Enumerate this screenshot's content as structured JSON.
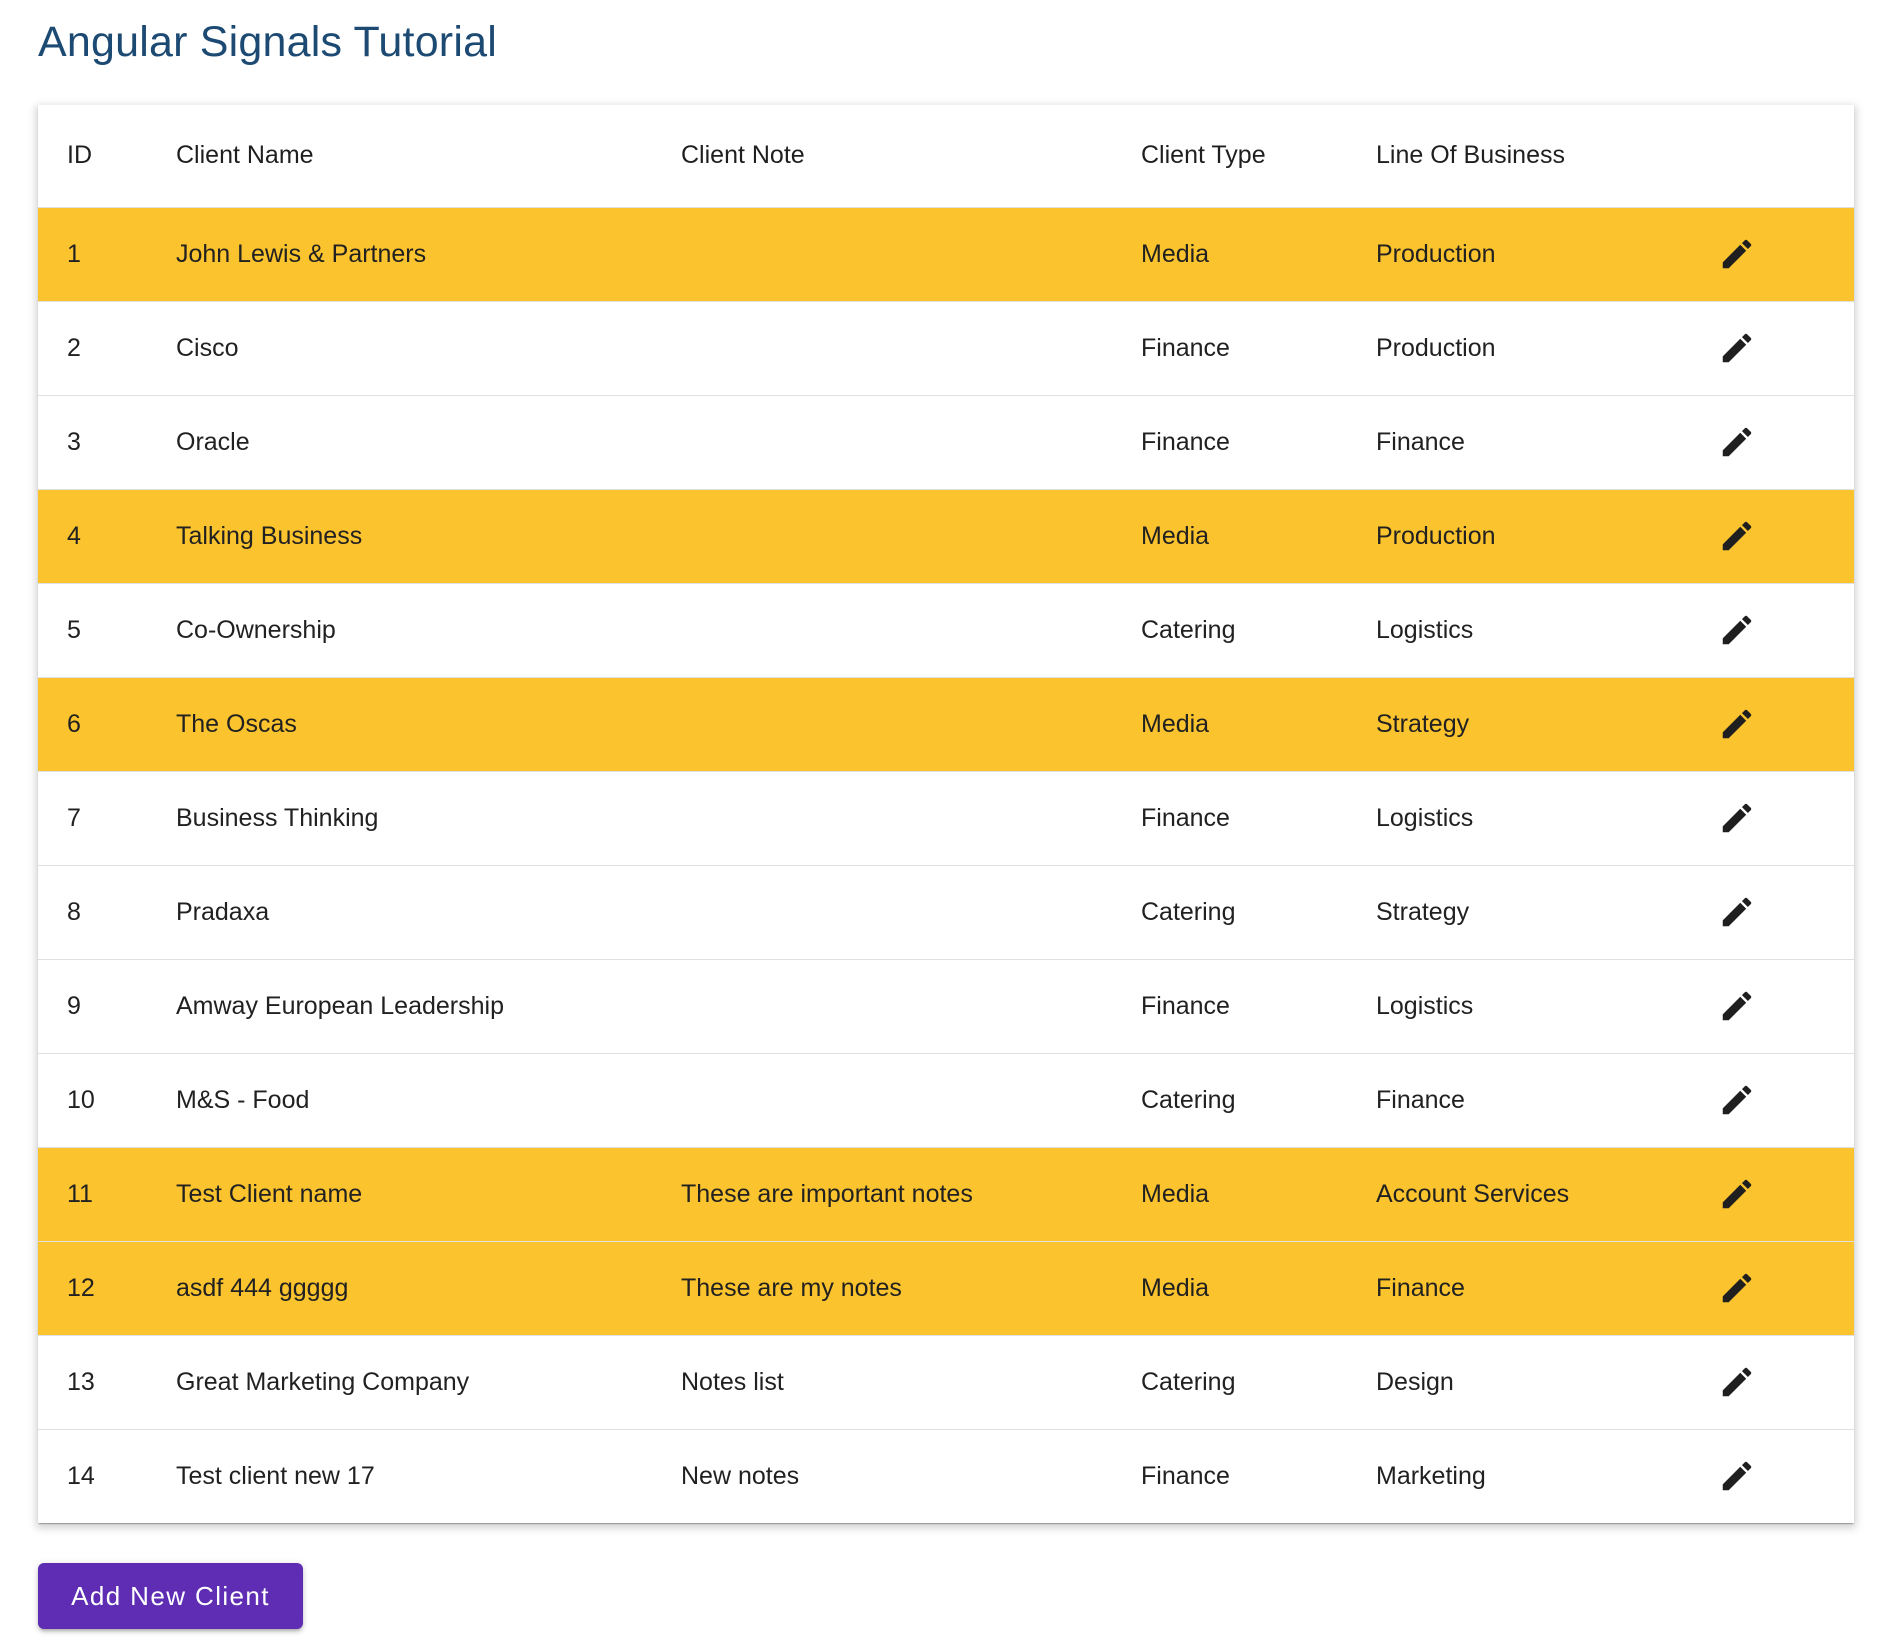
{
  "page": {
    "title": "Angular Signals Tutorial"
  },
  "colors": {
    "title": "#1c4a73",
    "media_row_highlight": "#fbc32d",
    "primary_button": "#5e2db3"
  },
  "table": {
    "columns": [
      "ID",
      "Client Name",
      "Client Note",
      "Client Type",
      "Line Of Business",
      ""
    ],
    "row_action_icon": "edit-icon",
    "rows": [
      {
        "id": "1",
        "name": "John Lewis & Partners",
        "note": "",
        "type": "Media",
        "lob": "Production"
      },
      {
        "id": "2",
        "name": "Cisco",
        "note": "",
        "type": "Finance",
        "lob": "Production"
      },
      {
        "id": "3",
        "name": "Oracle",
        "note": "",
        "type": "Finance",
        "lob": "Finance"
      },
      {
        "id": "4",
        "name": "Talking Business",
        "note": "",
        "type": "Media",
        "lob": "Production"
      },
      {
        "id": "5",
        "name": "Co-Ownership",
        "note": "",
        "type": "Catering",
        "lob": "Logistics"
      },
      {
        "id": "6",
        "name": "The Oscas",
        "note": "",
        "type": "Media",
        "lob": "Strategy"
      },
      {
        "id": "7",
        "name": "Business Thinking",
        "note": "",
        "type": "Finance",
        "lob": "Logistics"
      },
      {
        "id": "8",
        "name": "Pradaxa",
        "note": "",
        "type": "Catering",
        "lob": "Strategy"
      },
      {
        "id": "9",
        "name": "Amway European Leadership",
        "note": "",
        "type": "Finance",
        "lob": "Logistics"
      },
      {
        "id": "10",
        "name": "M&S - Food",
        "note": "",
        "type": "Catering",
        "lob": "Finance"
      },
      {
        "id": "11",
        "name": "Test Client name",
        "note": "These are important notes",
        "type": "Media",
        "lob": "Account Services"
      },
      {
        "id": "12",
        "name": "asdf 444 ggggg",
        "note": "These are my notes",
        "type": "Media",
        "lob": "Finance"
      },
      {
        "id": "13",
        "name": "Great Marketing Company",
        "note": "Notes list",
        "type": "Catering",
        "lob": "Design"
      },
      {
        "id": "14",
        "name": "Test client new 17",
        "note": "New notes",
        "type": "Finance",
        "lob": "Marketing"
      }
    ]
  },
  "actions": {
    "add_label": "Add New Client"
  }
}
